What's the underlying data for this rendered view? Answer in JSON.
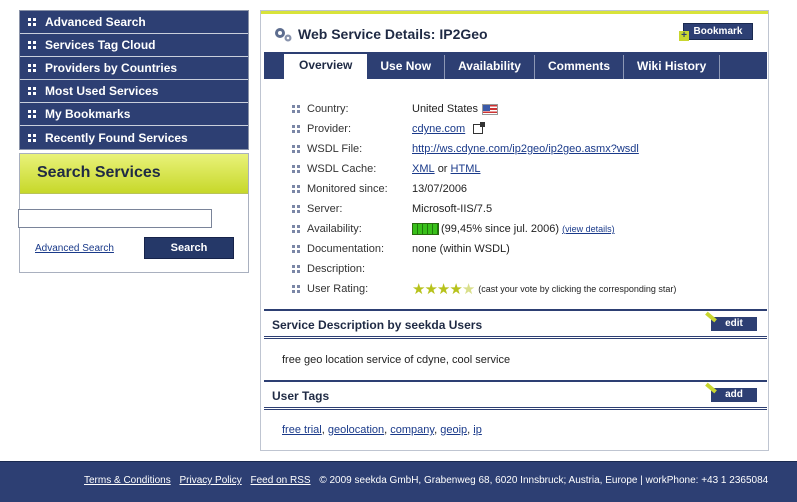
{
  "nav": {
    "items": [
      {
        "label": "Advanced Search"
      },
      {
        "label": "Services Tag Cloud"
      },
      {
        "label": "Providers by Countries"
      },
      {
        "label": "Most Used Services"
      },
      {
        "label": "My Bookmarks"
      },
      {
        "label": "Recently Found Services"
      }
    ]
  },
  "search": {
    "title": "Search Services",
    "input_value": "",
    "advanced_link": "Advanced Search",
    "button": "Search"
  },
  "main": {
    "title": "Web Service Details: IP2Geo",
    "bookmark_button": "Bookmark",
    "tabs": [
      {
        "label": "Overview",
        "active": true
      },
      {
        "label": "Use Now"
      },
      {
        "label": "Availability"
      },
      {
        "label": "Comments"
      },
      {
        "label": "Wiki History"
      }
    ]
  },
  "details": {
    "country": {
      "label": "Country:",
      "value": "United States"
    },
    "provider": {
      "label": "Provider:",
      "value": "cdyne.com"
    },
    "wsdl_file": {
      "label": "WSDL File:",
      "value": "http://ws.cdyne.com/ip2geo/ip2geo.asmx?wsdl"
    },
    "wsdl_cache": {
      "label": "WSDL Cache:",
      "xml": "XML",
      "or": "or",
      "html": "HTML"
    },
    "monitored": {
      "label": "Monitored since:",
      "value": "13/07/2006"
    },
    "server": {
      "label": "Server:",
      "value": "Microsoft-IIS/7.5"
    },
    "availability": {
      "label": "Availability:",
      "value": "(99,45% since jul. 2006)",
      "link": "(view details)",
      "percent": 99.45
    },
    "documentation": {
      "label": "Documentation:",
      "value": "none (within WSDL)"
    },
    "description": {
      "label": "Description:",
      "value": ""
    },
    "rating": {
      "label": "User Rating:",
      "stars": 4.5,
      "note": "(cast your vote by clicking the corresponding star)"
    }
  },
  "service_description": {
    "title": "Service Description by seekda Users",
    "edit_button": "edit",
    "text": "free geo location service of cdyne, cool service"
  },
  "user_tags": {
    "title": "User Tags",
    "add_button": "add",
    "tags": [
      "free trial",
      "geolocation",
      "company",
      "geoip",
      "ip"
    ]
  },
  "footer": {
    "terms": "Terms & Conditions",
    "privacy": "Privacy Policy",
    "rss": "Feed on RSS",
    "copyright": "© 2009 seekda GmbH, Grabenweg 68, 6020 Innsbruck; Austria, Europe | workPhone: +43 1 2365084"
  }
}
